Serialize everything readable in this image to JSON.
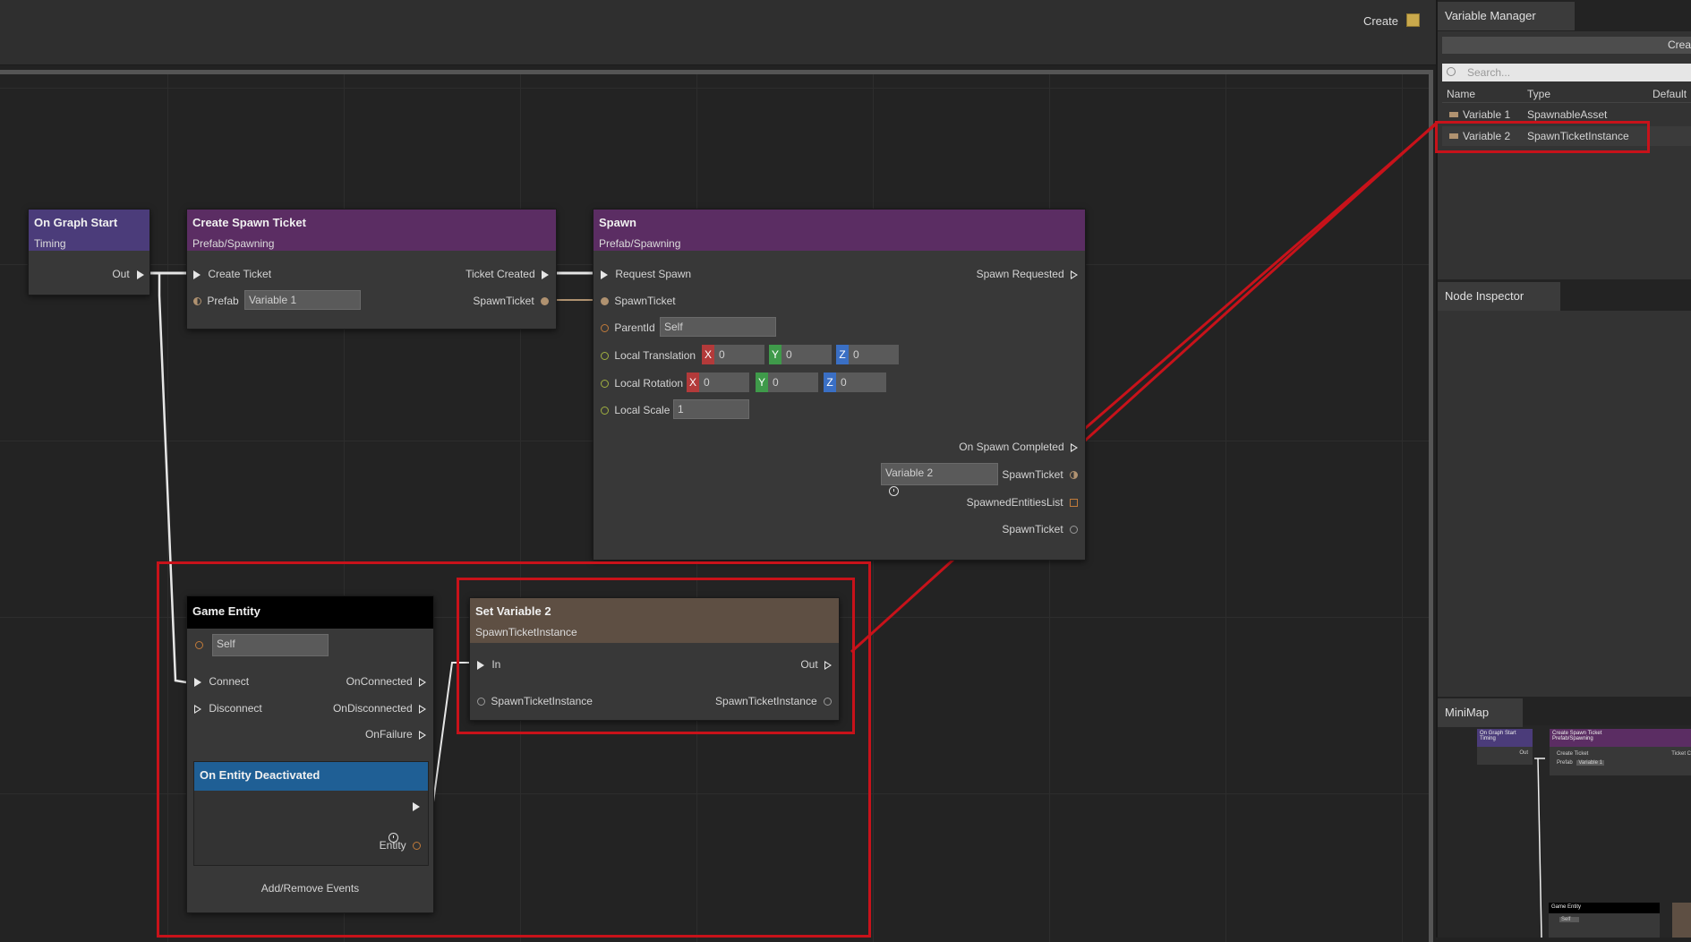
{
  "toolbar": {
    "create_label": "Create"
  },
  "nodes": {
    "on_graph_start": {
      "title": "On Graph Start",
      "subtitle": "Timing",
      "out": "Out",
      "color": "#4b3c7a"
    },
    "create_spawn_ticket": {
      "title": "Create Spawn Ticket",
      "subtitle": "Prefab/Spawning",
      "color": "#5b2d63",
      "in_label": "Create Ticket",
      "out_label": "Ticket Created",
      "prefab_label": "Prefab",
      "prefab_value": "Variable 1",
      "spawnticket_label": "SpawnTicket"
    },
    "spawn": {
      "title": "Spawn",
      "subtitle": "Prefab/Spawning",
      "color": "#5b2d63",
      "in_label": "Request Spawn",
      "out_label": "Spawn Requested",
      "spawnticket_label": "SpawnTicket",
      "parentid_label": "ParentId",
      "parentid_value": "Self",
      "local_translation_label": "Local Translation",
      "translation": {
        "x": "0",
        "y": "0",
        "z": "0"
      },
      "local_rotation_label": "Local Rotation",
      "rotation": {
        "x": "0",
        "y": "0",
        "z": "0"
      },
      "local_scale_label": "Local Scale",
      "scale_value": "1",
      "completed_label": "On Spawn Completed",
      "var2_value": "Variable 2",
      "out_spawnticket_label": "SpawnTicket",
      "spawned_list_label": "SpawnedEntitiesList",
      "out_spawnticket2_label": "SpawnTicket",
      "axis_labels": {
        "x": "X",
        "y": "Y",
        "z": "Z"
      }
    },
    "game_entity": {
      "title": "Game Entity",
      "self_value": "Self",
      "connect": "Connect",
      "on_connected": "OnConnected",
      "disconnect": "Disconnect",
      "on_disconnected": "OnDisconnected",
      "on_failure": "OnFailure",
      "sub_title": "On Entity Deactivated",
      "entity_label": "Entity",
      "add_remove": "Add/Remove Events"
    },
    "set_variable_2": {
      "title": "Set Variable 2",
      "subtitle": "SpawnTicketInstance",
      "color": "#5e4f43",
      "in_label": "In",
      "out_label": "Out",
      "in_var": "SpawnTicketInstance",
      "out_var": "SpawnTicketInstance"
    }
  },
  "variable_manager": {
    "tab": "Variable Manager",
    "create_button": "Crea",
    "search_placeholder": "Search...",
    "columns": [
      "Name",
      "Type",
      "Default"
    ],
    "rows": [
      {
        "name": "Variable 1",
        "type": "SpawnableAsset"
      },
      {
        "name": "Variable 2",
        "type": "SpawnTicketInstance"
      }
    ]
  },
  "node_inspector": {
    "tab": "Node Inspector"
  },
  "minimap": {
    "tab": "MiniMap",
    "on_graph_start": "On Graph Start",
    "timing": "Timing",
    "out": "Out",
    "create_spawn_ticket": "Create Spawn Ticket",
    "prefab_spawning": "Prefab/Spawning",
    "create_ticket": "Create Ticket",
    "ticket_c": "Ticket C",
    "prefab": "Prefab",
    "variable1": "Variable 1",
    "game_entity": "Game Entity",
    "self": "Self"
  },
  "colors": {
    "highlight": "#c8121a",
    "entity_sub": "#1f5f95"
  }
}
